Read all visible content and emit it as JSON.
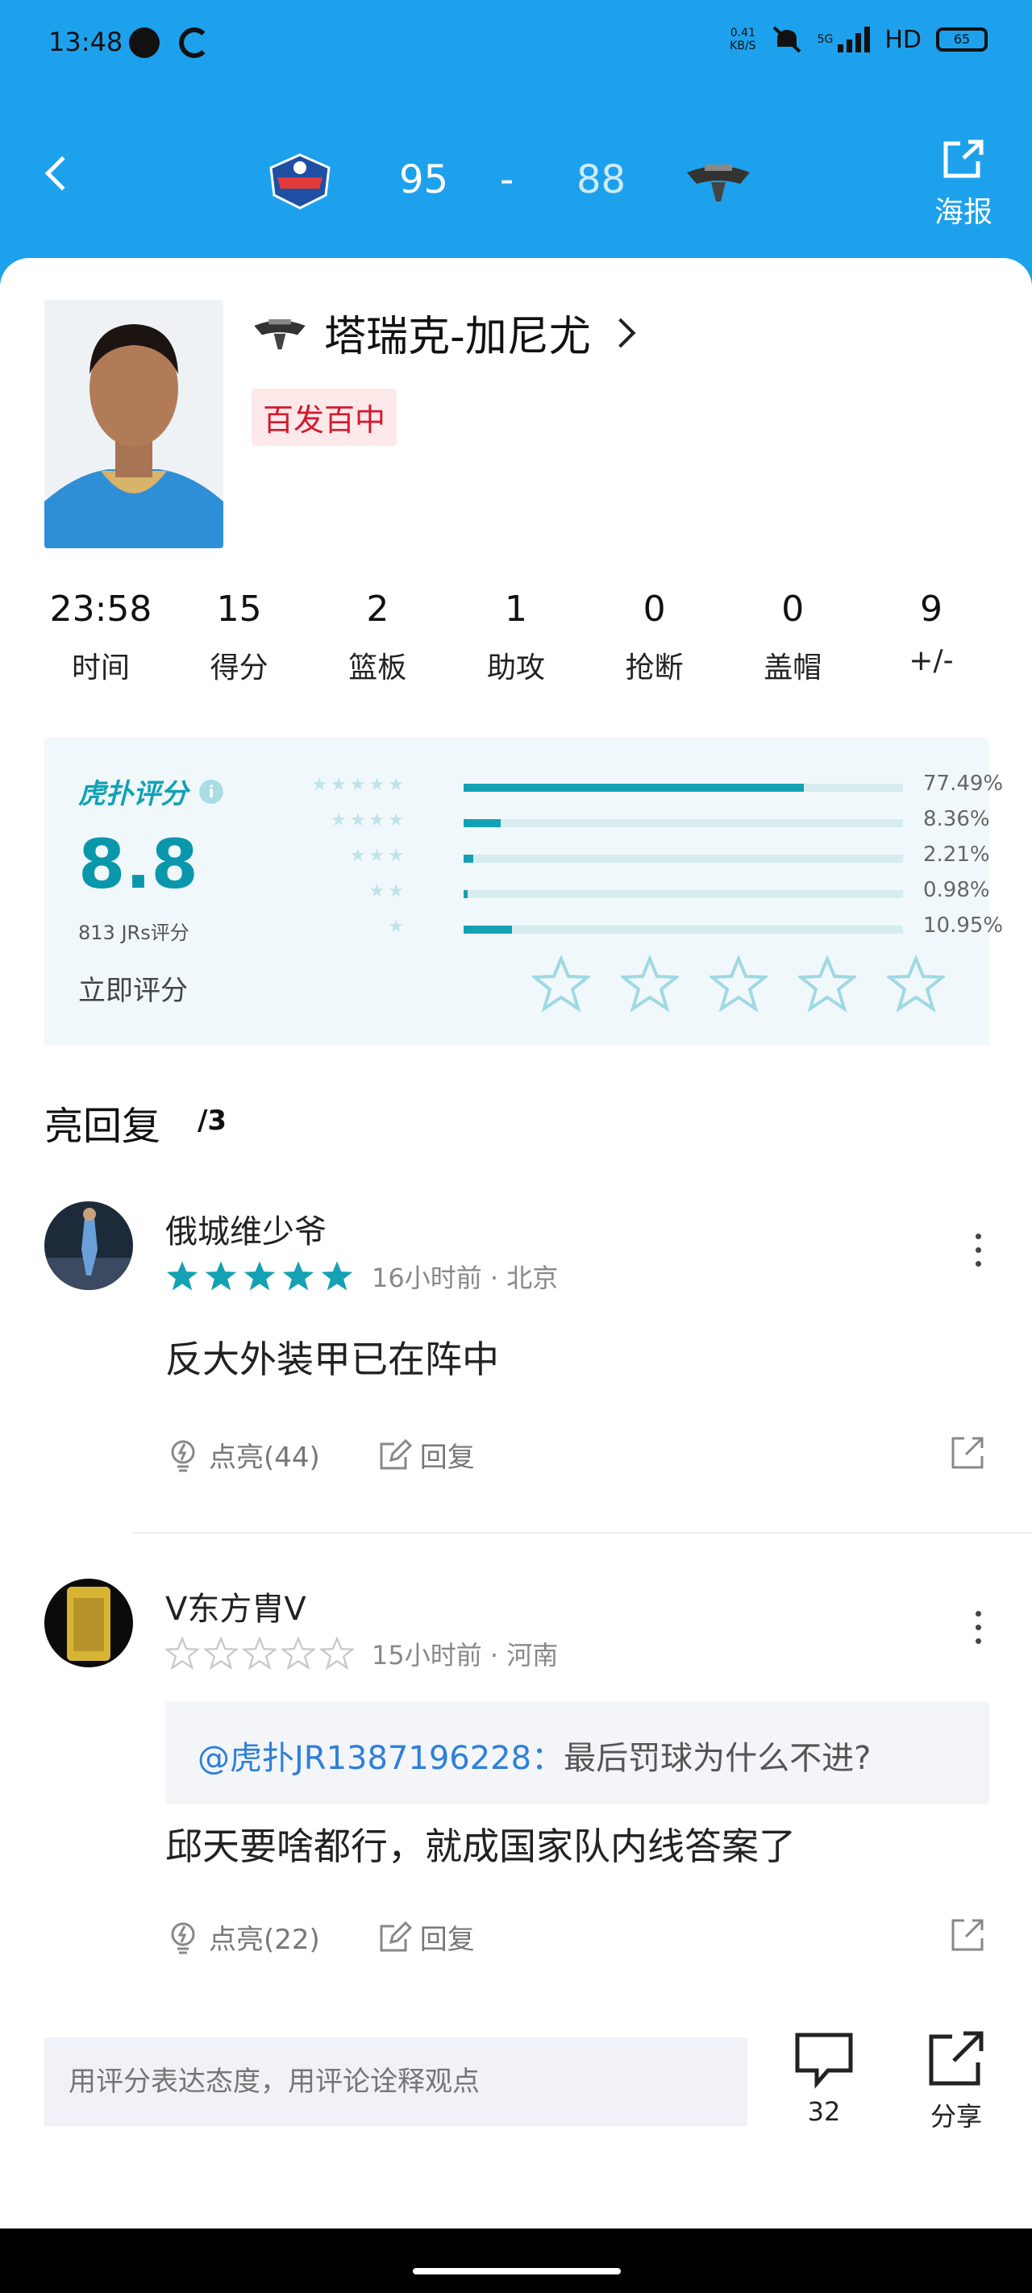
{
  "status": {
    "time": "13:48",
    "speed_top": "0.41",
    "speed_unit": "KB/S",
    "network": "HD",
    "signal_label": "5G",
    "battery": "65"
  },
  "header": {
    "home_score": "95",
    "separator": "-",
    "away_score": "88",
    "poster_label": "海报"
  },
  "player": {
    "name": "塔瑞克-加尼尤",
    "badge": "百发百中"
  },
  "stats": [
    {
      "value": "23:58",
      "label": "时间"
    },
    {
      "value": "15",
      "label": "得分"
    },
    {
      "value": "2",
      "label": "篮板"
    },
    {
      "value": "1",
      "label": "助攻"
    },
    {
      "value": "0",
      "label": "抢断"
    },
    {
      "value": "0",
      "label": "盖帽"
    },
    {
      "value": "9",
      "label": "+/-"
    }
  ],
  "rating": {
    "title": "虎扑评分",
    "score": "8.8",
    "count": "813 JRs评分",
    "rate_now": "立即评分",
    "distribution": [
      {
        "stars": 5,
        "pct_label": "77.49%",
        "pct": 77.49
      },
      {
        "stars": 4,
        "pct_label": "8.36%",
        "pct": 8.36
      },
      {
        "stars": 3,
        "pct_label": "2.21%",
        "pct": 2.21
      },
      {
        "stars": 2,
        "pct_label": "0.98%",
        "pct": 0.98
      },
      {
        "stars": 1,
        "pct_label": "10.95%",
        "pct": 10.95
      }
    ]
  },
  "comments_section": {
    "title": "亮回复",
    "count": "/3"
  },
  "comments": [
    {
      "user": "俄城维少爷",
      "stars": 5,
      "time": "16小时前 · 北京",
      "text": "反大外装甲已在阵中",
      "like_label": "点亮(44)",
      "reply_label": "回复"
    },
    {
      "user": "V东方胄V",
      "stars": 0,
      "time": "15小时前 · 河南",
      "quote_user": "@虎扑JR1387196228：",
      "quote_text": "最后罚球为什么不进?",
      "text": "邱天要啥都行，就成国家队内线答案了",
      "like_label": "点亮(22)",
      "reply_label": "回复"
    }
  ],
  "footer": {
    "input_placeholder": "用评分表达态度，用评论诠释观点",
    "comment_count": "32",
    "share_label": "分享"
  },
  "colors": {
    "header_blue": "#1da1ec",
    "teal": "#13a1b3",
    "badge_red": "#d21a2f",
    "star_green": "#13a1b3"
  }
}
